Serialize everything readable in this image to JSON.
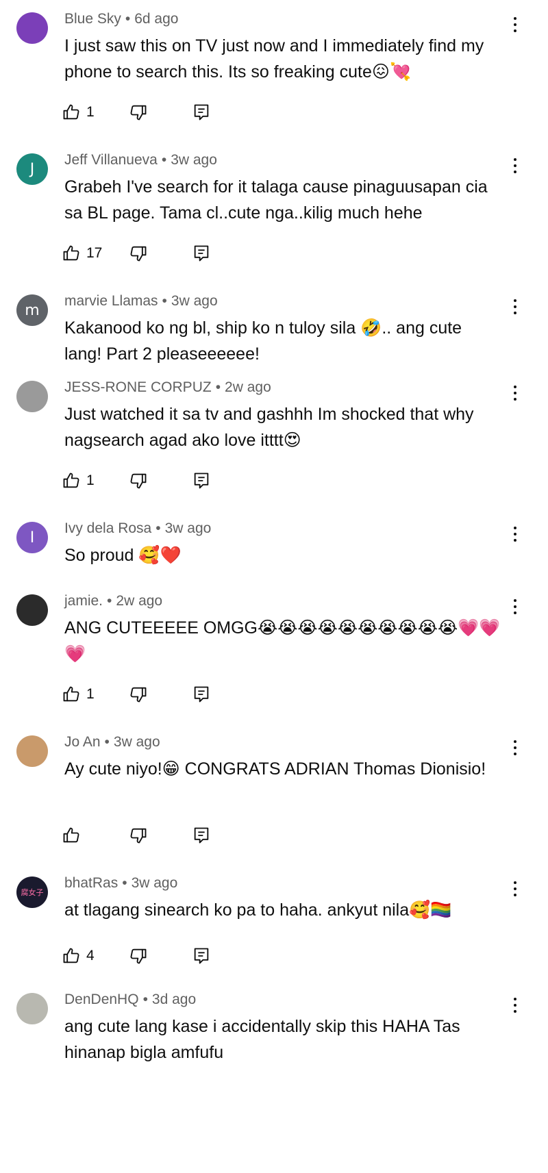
{
  "comments": [
    {
      "author": "Blue Sky",
      "time": "6d ago",
      "text": "I just saw this on TV just now and I immediately find my phone to search this. Its so freaking cute",
      "emojis": [
        "😖",
        "💘"
      ],
      "likes": "1",
      "avatar_letter": "",
      "avatar_color": "#7b3fb8",
      "show_actions": true
    },
    {
      "author": "Jeff Villanueva",
      "time": "3w ago",
      "text": "Grabeh I've search for it talaga cause pinaguusapan cia sa BL page. Tama cl..cute nga..kilig much hehe",
      "emojis": [],
      "likes": "17",
      "avatar_letter": "J",
      "avatar_color": "#1c8a7d",
      "show_actions": true
    },
    {
      "author": "marvie Llamas",
      "time": "3w ago",
      "text": "Kakanood ko ng bl, ship ko n tuloy sila 🤣.. ang cute lang! Part 2 pleaseeeeee!",
      "emojis": [],
      "likes": "",
      "avatar_letter": "m",
      "avatar_color": "#5f6368",
      "show_actions": false
    },
    {
      "author": "JESS-RONE CORPUZ",
      "time": "2w ago",
      "text": "Just watched it sa tv and gashhh Im shocked that why nagsearch agad ako love itttt",
      "emojis": [
        "😍"
      ],
      "likes": "1",
      "avatar_letter": "",
      "avatar_color": "#9a9a9a",
      "show_actions": true
    },
    {
      "author": "Ivy dela Rosa",
      "time": "3w ago",
      "text": "So proud ",
      "emojis": [
        "🥰",
        "❤️"
      ],
      "likes": "",
      "avatar_letter": "I",
      "avatar_color": "#7e57c2",
      "show_actions": false
    },
    {
      "author": "jamie.",
      "time": "2w ago",
      "text": "ANG CUTEEEEE OMGG",
      "emojis": [
        "😭",
        "😭",
        "😭",
        "😭",
        "😭",
        "😭",
        "😭",
        "😭",
        "😭",
        "😭",
        "💗",
        "💗",
        "💗"
      ],
      "likes": "1",
      "avatar_letter": "",
      "avatar_color": "#2b2b2b",
      "show_actions": true
    },
    {
      "author": "Jo An",
      "time": "3w ago",
      "text": "Ay cute niyo!😁 CONGRATS ADRIAN Thomas Dionisio!",
      "emojis": [],
      "likes": "",
      "avatar_letter": "",
      "avatar_color": "#c99a6b",
      "show_actions": true
    },
    {
      "author": "bhatRas",
      "time": "3w ago",
      "text": "at tlagang sinearch ko pa to haha. ankyut nila",
      "emojis": [
        "🥰",
        "🏳️‍🌈"
      ],
      "likes": "4",
      "avatar_letter": "",
      "avatar_color": "#1a1a2e",
      "avatar_text": "腐女子",
      "show_actions": true
    },
    {
      "author": "DenDenHQ",
      "time": "3d ago",
      "text": "ang cute lang kase i accidentally skip this HAHA Tas hinanap bigla amfufu",
      "emojis": [],
      "likes": "",
      "avatar_letter": "",
      "avatar_color": "#b8b8b0",
      "show_actions": false
    }
  ],
  "separator": "•",
  "icons": {
    "like": "thumbs-up-icon",
    "dislike": "thumbs-down-icon",
    "reply": "reply-icon",
    "menu": "more-vert-icon"
  }
}
